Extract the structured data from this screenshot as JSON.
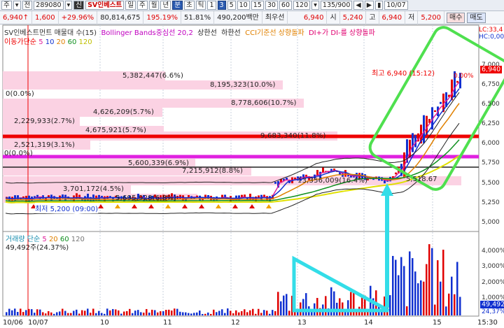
{
  "toolbar": {
    "items": [
      "주",
      "▾",
      "전",
      "289080",
      "▾",
      "신",
      "SV인베스트",
      "일",
      "주",
      "월",
      "년",
      "분",
      "초",
      "틱",
      "1",
      "3",
      "5",
      "10",
      "15",
      "30",
      "60",
      "120",
      "▾",
      "135/900",
      "◀",
      "▶",
      "▮",
      "10/07"
    ]
  },
  "quote": {
    "price": "6,940",
    "up_arrow": "↑",
    "change": "1,600",
    "change_pct": "+29.96%",
    "volume": "80,814,675",
    "vol_ratio": "195.19%",
    "rotation": "51.81%",
    "amount": "490,200백만",
    "broker": "최우선",
    "bid": "6,940",
    "open_label": "시",
    "open": "5,240",
    "high_label": "고",
    "high": "6,940",
    "low_label": "저",
    "low": "5,200",
    "buy": "매수",
    "sell": "매도"
  },
  "legend": {
    "title": "SV인베스트먼트 매물대 수(15)",
    "bb": "Bollinger Bands중심선 20,2",
    "upper": "상한선",
    "lower": "하한선",
    "cci": "CCI기준선 상향돌파",
    "di": "DI+가 DI-를 상향돌파",
    "ma_label": "이동가단순",
    "ma_periods": [
      "5",
      "10",
      "20",
      "60",
      "120"
    ],
    "lc": "LC:33,4",
    "hc": "HC:0,00"
  },
  "profile": [
    {
      "label": "5,382,447(6.6%)"
    },
    {
      "label": "8,195,323(10.0%)"
    },
    {
      "label": "0(0.0%)"
    },
    {
      "label": "8,778,606(10.7%)"
    },
    {
      "label": "4,626,209(5.7%)"
    },
    {
      "label": "2,229,933(2.7%)"
    },
    {
      "label": "4,675,921(5.7%)"
    },
    {
      "label": "9,683,340(11.8%)"
    },
    {
      "label": "2,521,319(3.1%)"
    },
    {
      "label": "0(0.0%)"
    },
    {
      "label": "5,600,339(6.9%)"
    },
    {
      "label": "7,215,912(8.8%)"
    },
    {
      "label": "13,356,009(16.4%)"
    },
    {
      "label": "3,701,172(4.5%)"
    },
    {
      "label": "5,695,928(6.8%)"
    }
  ],
  "annotations": {
    "high": "최고 6,940 (15:12)",
    "low": "최저 5,200 (09:00)",
    "current_line": "5,518.67"
  },
  "price_axis": [
    "7,000",
    "6,750",
    "6,500",
    "6,250",
    "6,000",
    "5,750",
    "5,500",
    "5,250",
    "5,000"
  ],
  "price_tag": "6,940",
  "price_pct": "0.00%",
  "volume_legend": {
    "label": "거래량 단순",
    "periods": [
      "5",
      "20",
      "60",
      "120"
    ],
    "value": "49,492주(24.37%)"
  },
  "volume_axis": [
    "4,000%",
    "3,000%",
    "2,000%",
    "1,000%"
  ],
  "volume_tag": "49,492",
  "volume_tag2": "24,37%",
  "x_axis": [
    "10/06",
    "10/07",
    "10",
    "11",
    "12",
    "13",
    "14",
    "15",
    "15:30"
  ],
  "colors": {
    "up": "#e00000",
    "down": "#1030d0",
    "ma5": "#e0209a",
    "bb": "#222222",
    "annot": "#22ee22",
    "arrow": "#33ddee"
  }
}
